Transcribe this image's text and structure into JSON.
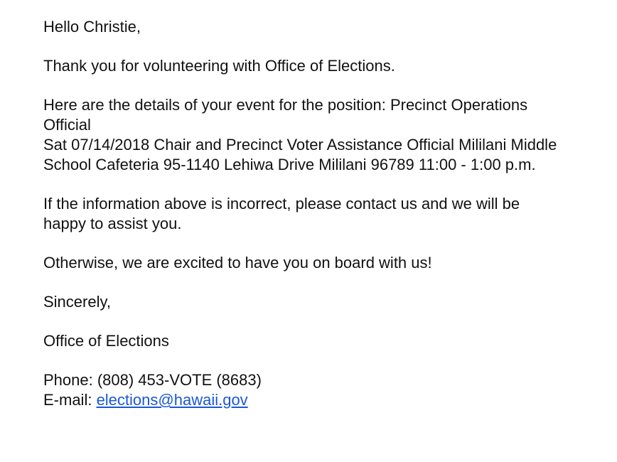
{
  "email": {
    "greeting": "Hello Christie,",
    "thanks": "Thank you for volunteering with Office of Elections.",
    "details_intro_line1": "Here are the details of your event for the position: Precinct Operations",
    "details_intro_line2": "Official",
    "event_line1": "Sat 07/14/2018 Chair and Precinct Voter Assistance Official Mililani Middle",
    "event_line2": "School Cafeteria 95-1140 Lehiwa Drive Mililani 96789 11:00 - 1:00 p.m.",
    "incorrect_line1": "If the information above is incorrect, please contact us and we will be",
    "incorrect_line2": "happy to assist you.",
    "excited": "Otherwise, we are excited to have you on board with us!",
    "closing": "Sincerely,",
    "signature": "Office of Elections",
    "phone_line": "Phone: (808) 453-VOTE (8683)",
    "email_label": "E-mail: ",
    "email_address": "elections@hawaii.gov"
  },
  "colors": {
    "text": "#111111",
    "link": "#1a57d6",
    "background": "#ffffff"
  }
}
